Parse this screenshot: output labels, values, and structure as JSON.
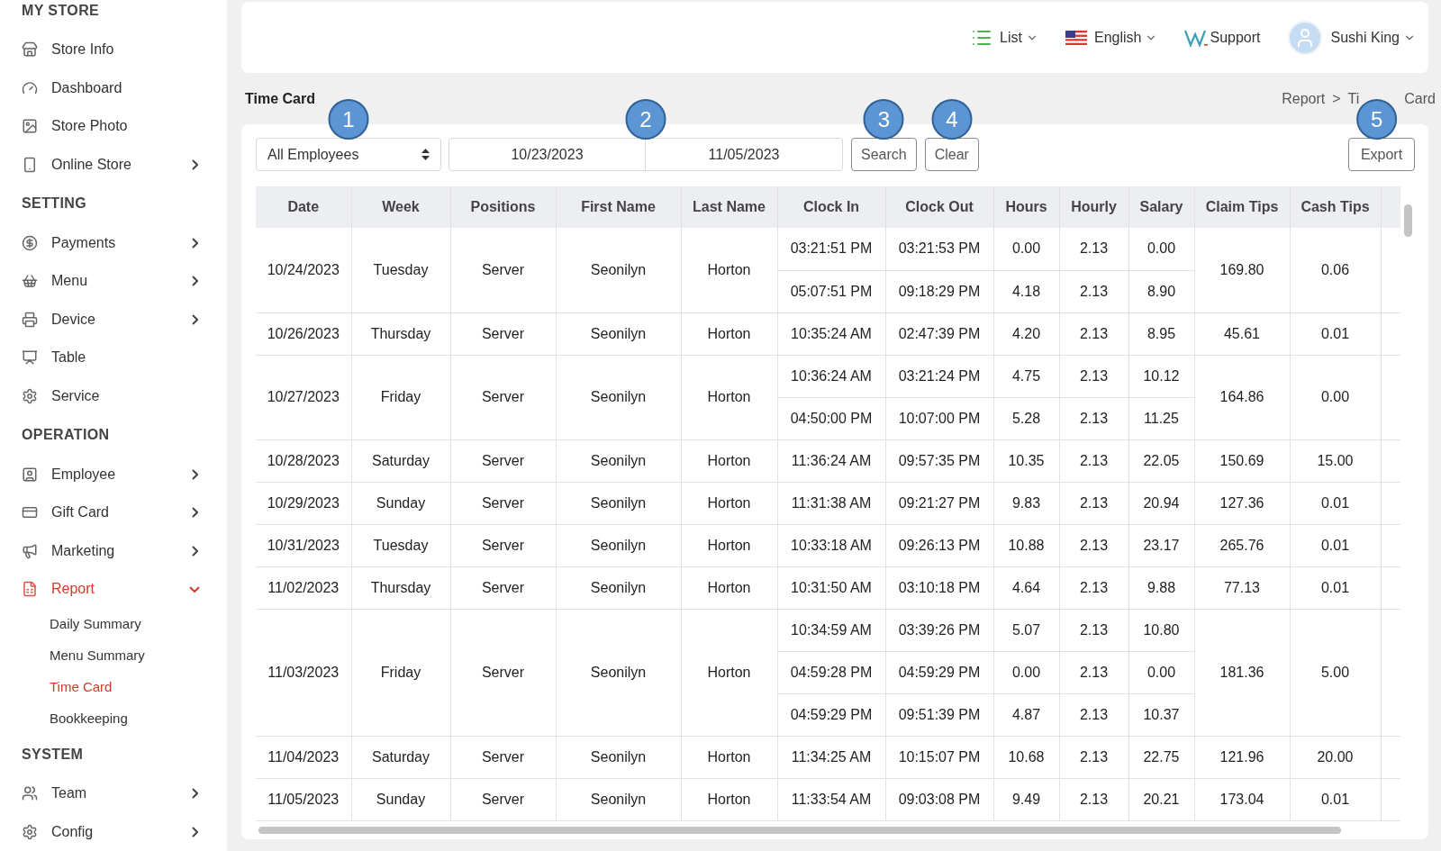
{
  "sidebar": {
    "sections": [
      {
        "title": "MY STORE",
        "items": [
          {
            "label": "Store Info",
            "selected": false
          },
          {
            "label": "Dashboard",
            "selected": false
          },
          {
            "label": "Store Photo",
            "selected": false
          },
          {
            "label": "Online Store",
            "expanded": false,
            "selected": false
          }
        ]
      },
      {
        "title": "SETTING",
        "items": [
          {
            "label": "Payments",
            "expanded": false,
            "selected": false
          },
          {
            "label": "Menu",
            "expanded": false,
            "selected": false
          },
          {
            "label": "Device",
            "expanded": false,
            "selected": false
          },
          {
            "label": "Table",
            "selected": false
          },
          {
            "label": "Service",
            "selected": false
          }
        ]
      },
      {
        "title": "OPERATION",
        "items": [
          {
            "label": "Employee",
            "expanded": false,
            "selected": false
          },
          {
            "label": "Gift Card",
            "expanded": false,
            "selected": false
          },
          {
            "label": "Marketing",
            "expanded": false,
            "selected": false
          },
          {
            "label": "Report",
            "expanded": true,
            "selected": true,
            "children": [
              {
                "label": "Daily Summary",
                "selected": false
              },
              {
                "label": "Menu Summary",
                "selected": false
              },
              {
                "label": "Time Card",
                "selected": true
              },
              {
                "label": "Bookkeeping",
                "selected": false
              }
            ]
          }
        ]
      },
      {
        "title": "SYSTEM",
        "items": [
          {
            "label": "Team",
            "expanded": false,
            "selected": false
          },
          {
            "label": "Config",
            "expanded": false,
            "selected": false
          }
        ]
      }
    ]
  },
  "topbar": {
    "view_menu": "List",
    "language": "English",
    "support": "Support",
    "user": "Sushi King"
  },
  "page": {
    "title": "Time Card",
    "breadcrumb": [
      "Report",
      ">",
      "Ti",
      "Card"
    ]
  },
  "filters": {
    "employee_select": {
      "value": "All Employees",
      "marker": "1"
    },
    "date_range": {
      "start": "10/23/2023",
      "end": "11/05/2023",
      "marker": "2"
    },
    "search_button": {
      "label": "Search",
      "marker": "3"
    },
    "clear_button": {
      "label": "Clear",
      "marker": "4"
    },
    "export_button": {
      "label": "Export",
      "marker": "5"
    }
  },
  "table": {
    "columns": [
      "Date",
      "Week",
      "Positions",
      "First Name",
      "Last Name",
      "Clock In",
      "Clock Out",
      "Hours",
      "Hourly",
      "Salary",
      "Claim Tips",
      "Cash Tips"
    ],
    "rows": [
      {
        "date": "10/24/2023",
        "week": "Tuesday",
        "position": "Server",
        "first_name": "Seonilyn",
        "last_name": "Horton",
        "claim_tips": "169.80",
        "cash_tips": "0.06",
        "shifts": [
          {
            "clock_in": "03:21:51 PM",
            "clock_out": "03:21:53 PM",
            "hours": "0.00",
            "hourly": "2.13",
            "salary": "0.00"
          },
          {
            "clock_in": "05:07:51 PM",
            "clock_out": "09:18:29 PM",
            "hours": "4.18",
            "hourly": "2.13",
            "salary": "8.90"
          }
        ]
      },
      {
        "date": "10/26/2023",
        "week": "Thursday",
        "position": "Server",
        "first_name": "Seonilyn",
        "last_name": "Horton",
        "claim_tips": "45.61",
        "cash_tips": "0.01",
        "shifts": [
          {
            "clock_in": "10:35:24 AM",
            "clock_out": "02:47:39 PM",
            "hours": "4.20",
            "hourly": "2.13",
            "salary": "8.95"
          }
        ]
      },
      {
        "date": "10/27/2023",
        "week": "Friday",
        "position": "Server",
        "first_name": "Seonilyn",
        "last_name": "Horton",
        "claim_tips": "164.86",
        "cash_tips": "0.00",
        "shifts": [
          {
            "clock_in": "10:36:24 AM",
            "clock_out": "03:21:24 PM",
            "hours": "4.75",
            "hourly": "2.13",
            "salary": "10.12"
          },
          {
            "clock_in": "04:50:00 PM",
            "clock_out": "10:07:00 PM",
            "hours": "5.28",
            "hourly": "2.13",
            "salary": "11.25"
          }
        ]
      },
      {
        "date": "10/28/2023",
        "week": "Saturday",
        "position": "Server",
        "first_name": "Seonilyn",
        "last_name": "Horton",
        "claim_tips": "150.69",
        "cash_tips": "15.00",
        "shifts": [
          {
            "clock_in": "11:36:24 AM",
            "clock_out": "09:57:35 PM",
            "hours": "10.35",
            "hourly": "2.13",
            "salary": "22.05"
          }
        ]
      },
      {
        "date": "10/29/2023",
        "week": "Sunday",
        "position": "Server",
        "first_name": "Seonilyn",
        "last_name": "Horton",
        "claim_tips": "127.36",
        "cash_tips": "0.01",
        "shifts": [
          {
            "clock_in": "11:31:38 AM",
            "clock_out": "09:21:27 PM",
            "hours": "9.83",
            "hourly": "2.13",
            "salary": "20.94"
          }
        ]
      },
      {
        "date": "10/31/2023",
        "week": "Tuesday",
        "position": "Server",
        "first_name": "Seonilyn",
        "last_name": "Horton",
        "claim_tips": "265.76",
        "cash_tips": "0.01",
        "shifts": [
          {
            "clock_in": "10:33:18 AM",
            "clock_out": "09:26:13 PM",
            "hours": "10.88",
            "hourly": "2.13",
            "salary": "23.17"
          }
        ]
      },
      {
        "date": "11/02/2023",
        "week": "Thursday",
        "position": "Server",
        "first_name": "Seonilyn",
        "last_name": "Horton",
        "claim_tips": "77.13",
        "cash_tips": "0.01",
        "shifts": [
          {
            "clock_in": "10:31:50 AM",
            "clock_out": "03:10:18 PM",
            "hours": "4.64",
            "hourly": "2.13",
            "salary": "9.88"
          }
        ]
      },
      {
        "date": "11/03/2023",
        "week": "Friday",
        "position": "Server",
        "first_name": "Seonilyn",
        "last_name": "Horton",
        "claim_tips": "181.36",
        "cash_tips": "5.00",
        "shifts": [
          {
            "clock_in": "10:34:59 AM",
            "clock_out": "03:39:26 PM",
            "hours": "5.07",
            "hourly": "2.13",
            "salary": "10.80"
          },
          {
            "clock_in": "04:59:28 PM",
            "clock_out": "04:59:29 PM",
            "hours": "0.00",
            "hourly": "2.13",
            "salary": "0.00"
          },
          {
            "clock_in": "04:59:29 PM",
            "clock_out": "09:51:39 PM",
            "hours": "4.87",
            "hourly": "2.13",
            "salary": "10.37"
          }
        ]
      },
      {
        "date": "11/04/2023",
        "week": "Saturday",
        "position": "Server",
        "first_name": "Seonilyn",
        "last_name": "Horton",
        "claim_tips": "121.96",
        "cash_tips": "20.00",
        "shifts": [
          {
            "clock_in": "11:34:25 AM",
            "clock_out": "10:15:07 PM",
            "hours": "10.68",
            "hourly": "2.13",
            "salary": "22.75"
          }
        ]
      },
      {
        "date": "11/05/2023",
        "week": "Sunday",
        "position": "Server",
        "first_name": "Seonilyn",
        "last_name": "Horton",
        "claim_tips": "173.04",
        "cash_tips": "0.01",
        "shifts": [
          {
            "clock_in": "11:33:54 AM",
            "clock_out": "09:03:08 PM",
            "hours": "9.49",
            "hourly": "2.13",
            "salary": "20.21"
          }
        ]
      }
    ]
  }
}
